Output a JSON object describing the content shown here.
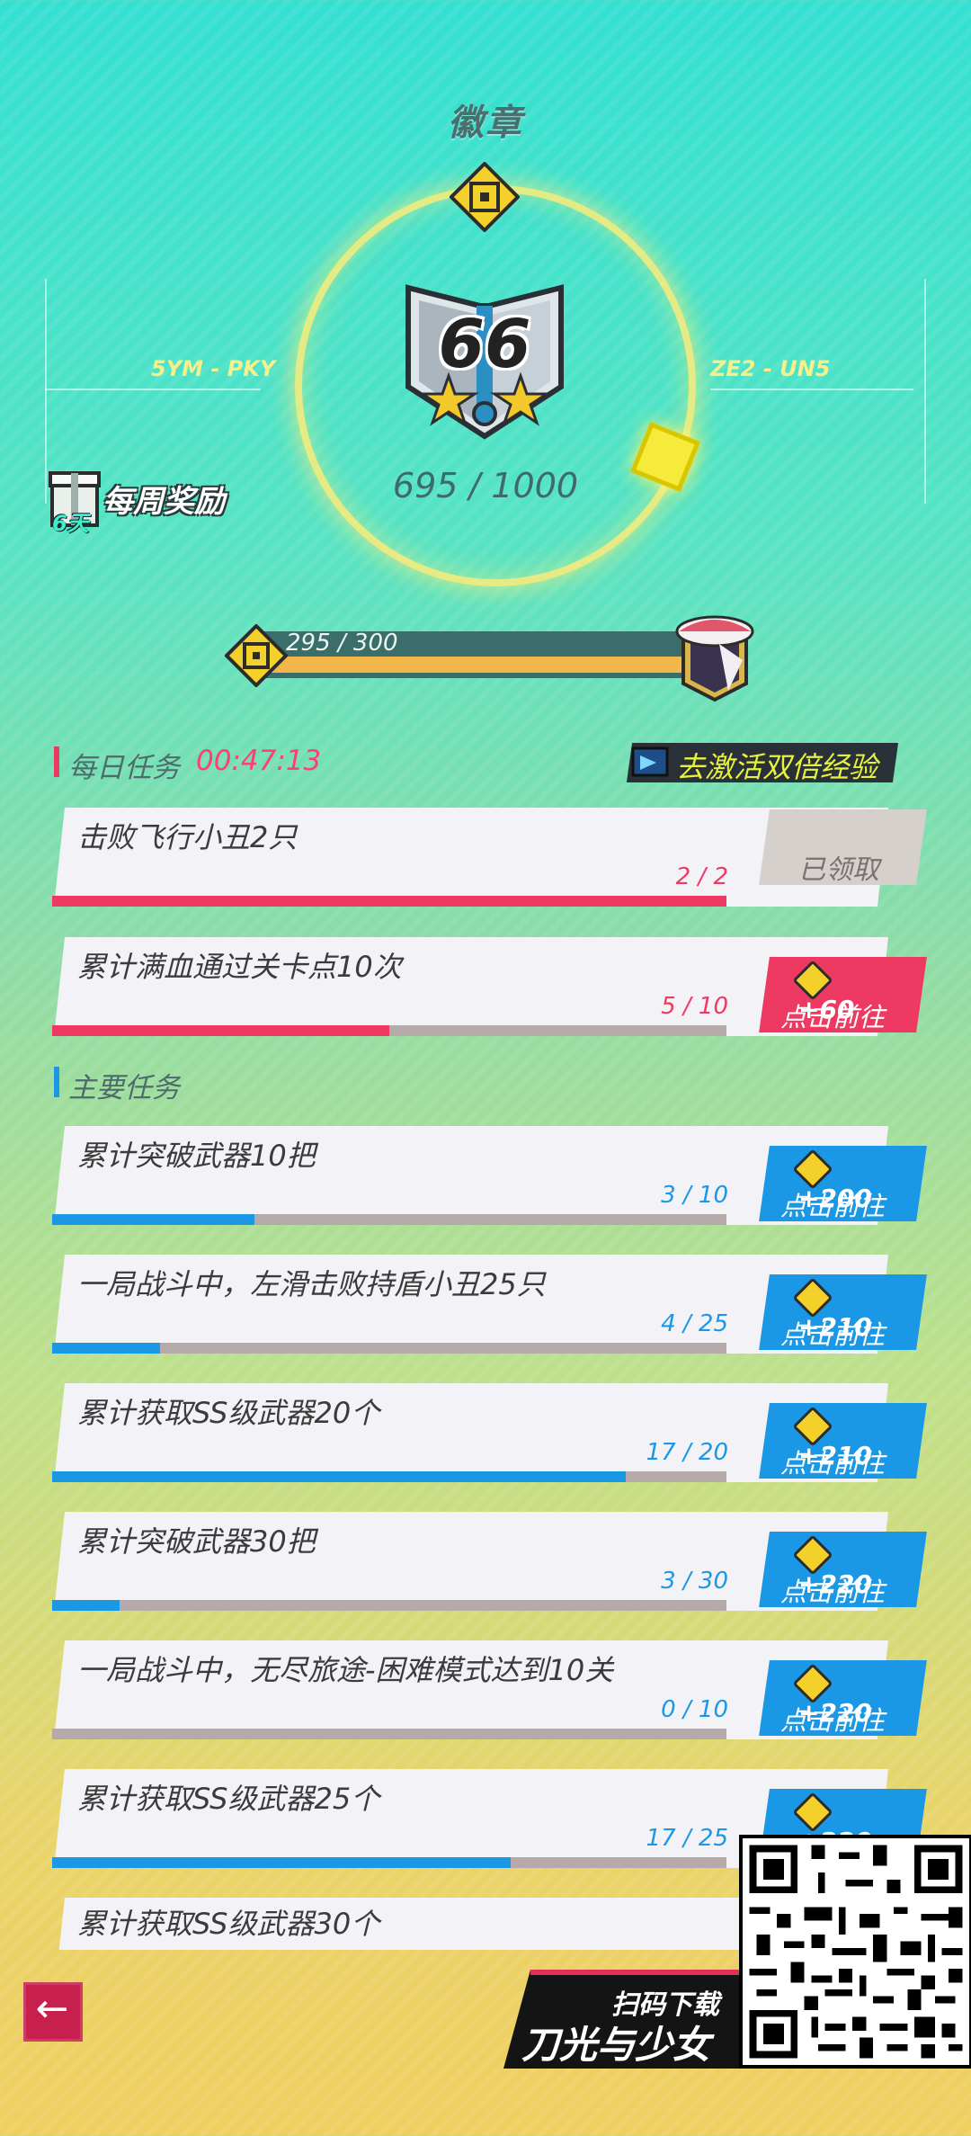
{
  "header": {
    "title": "徽章"
  },
  "badge": {
    "rank": "66",
    "progress": "695 / 1000",
    "left_label": "5YM - PKY",
    "right_label": "ZE2 - UN5"
  },
  "weekly": {
    "label": "每周奖励",
    "days": "6天"
  },
  "exp": {
    "text": "295 / 300",
    "fraction": 0.983
  },
  "daily": {
    "title": "每日任务",
    "timer": "00:47:13",
    "double_label": "去激活双倍经验",
    "tasks": [
      {
        "title": "击败飞行小丑2只",
        "count": "2 / 2",
        "progress": 1.0,
        "button": "已领取",
        "reward": ""
      },
      {
        "title": "累计满血通过关卡点10次",
        "count": "5 / 10",
        "progress": 0.5,
        "button": "点击前往",
        "reward": "+60"
      }
    ]
  },
  "main": {
    "title": "主要任务",
    "tasks": [
      {
        "title": "累计突破武器10把",
        "count": "3 / 10",
        "progress": 0.3,
        "button": "点击前往",
        "reward": "+200"
      },
      {
        "title": "一局战斗中，左滑击败持盾小丑25只",
        "count": "4 / 25",
        "progress": 0.16,
        "button": "点击前往",
        "reward": "+210"
      },
      {
        "title": "累计获取SS级武器20个",
        "count": "17 / 20",
        "progress": 0.85,
        "button": "点击前往",
        "reward": "+210"
      },
      {
        "title": "累计突破武器30把",
        "count": "3 / 30",
        "progress": 0.1,
        "button": "点击前往",
        "reward": "+220"
      },
      {
        "title": "一局战斗中，无尽旅途-困难模式达到10关",
        "count": "0 / 10",
        "progress": 0.0,
        "button": "点击前往",
        "reward": "+220"
      },
      {
        "title": "累计获取SS级武器25个",
        "count": "17 / 25",
        "progress": 0.68,
        "button": "",
        "reward": "+220"
      },
      {
        "title": "累计获取SS级武器30个",
        "count": "",
        "progress": 0.0,
        "button": "",
        "reward": ""
      }
    ]
  },
  "promo": {
    "scan_label": "扫码下载",
    "game_name": "刀光与少女"
  },
  "colors": {
    "daily_accent": "#ee3a62",
    "main_accent": "#1a98e6",
    "claimed": "#d6d0cc",
    "go_daily": "#ee3a62",
    "go_main": "#1a98e6"
  }
}
